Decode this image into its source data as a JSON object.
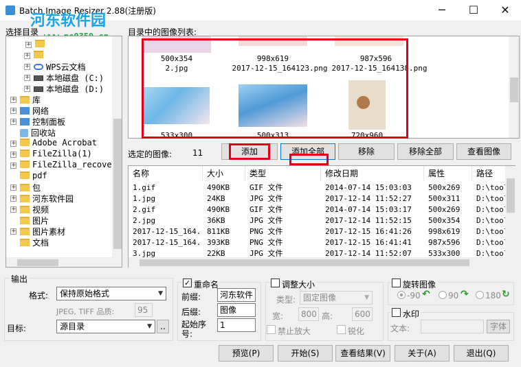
{
  "window": {
    "title": "Batch Image Resizer 2.88(注册版)",
    "minimize": "─",
    "maximize": "☐",
    "close": "✕"
  },
  "watermark": {
    "logo": "河东软件园",
    "url": "www.pc0359.cn"
  },
  "tree": {
    "label": "选择目录",
    "items": [
      {
        "label": "",
        "icon": "music-folder-icon"
      },
      {
        "label": "",
        "icon": "folder-icon"
      },
      {
        "label": "WPS云文档",
        "icon": "cloud-icon"
      },
      {
        "label": "本地磁盘 (C:)",
        "icon": "drive-icon"
      },
      {
        "label": "本地磁盘 (D:)",
        "icon": "drive-icon"
      },
      {
        "label": "库",
        "icon": "folder-icon"
      },
      {
        "label": "网络",
        "icon": "network-icon"
      },
      {
        "label": "控制面板",
        "icon": "control-panel-icon"
      },
      {
        "label": "回收站",
        "icon": "recycle-bin-icon"
      },
      {
        "label": "Adobe Acrobat",
        "icon": "folder-icon"
      },
      {
        "label": "FileZilla(1)",
        "icon": "folder-icon"
      },
      {
        "label": "FileZilla_recovered",
        "icon": "folder-icon"
      },
      {
        "label": "pdf",
        "icon": "folder-icon"
      },
      {
        "label": "包",
        "icon": "folder-icon"
      },
      {
        "label": "河东软件园",
        "icon": "folder-icon"
      },
      {
        "label": "视频",
        "icon": "folder-icon"
      },
      {
        "label": "图片",
        "icon": "folder-icon"
      },
      {
        "label": "图片素材",
        "icon": "folder-icon"
      },
      {
        "label": "文档",
        "icon": "folder-icon"
      }
    ]
  },
  "images_panel": {
    "label": "目录中的图像列表:",
    "thumbs": [
      {
        "size": "500x354",
        "name": "2.jpg"
      },
      {
        "size": "998x619",
        "name": "2017-12-15_164123.png"
      },
      {
        "size": "987x596",
        "name": "2017-12-15_164138.png"
      },
      {
        "size": "533x300",
        "name": ""
      },
      {
        "size": "500x313",
        "name": ""
      },
      {
        "size": "720x960",
        "name": ""
      }
    ]
  },
  "selected": {
    "label": "选定的图像:",
    "count": "11",
    "buttons": {
      "add": "添加",
      "add_all": "添加全部",
      "remove": "移除",
      "remove_all": "移除全部",
      "view": "查看图像"
    }
  },
  "table": {
    "columns": [
      "名称",
      "大小",
      "类型",
      "修改日期",
      "属性",
      "路径"
    ],
    "rows": [
      [
        "1.gif",
        "490KB",
        "GIF 文件",
        "2014-07-14 15:03:03",
        "500x269",
        "D:\\tool"
      ],
      [
        "1.jpg",
        "24KB",
        "JPG 文件",
        "2017-12-14 11:52:27",
        "500x311",
        "D:\\tool"
      ],
      [
        "2.gif",
        "490KB",
        "GIF 文件",
        "2014-07-14 15:03:17",
        "500x269",
        "D:\\tool"
      ],
      [
        "2.jpg",
        "36KB",
        "JPG 文件",
        "2017-12-14 11:52:15",
        "500x354",
        "D:\\tool"
      ],
      [
        "2017-12-15_164...",
        "811KB",
        "PNG 文件",
        "2017-12-15 16:41:26",
        "998x619",
        "D:\\tool"
      ],
      [
        "2017-12-15_164...",
        "393KB",
        "PNG 文件",
        "2017-12-15 16:41:41",
        "987x596",
        "D:\\tool"
      ],
      [
        "3.jpg",
        "22KB",
        "JPG 文件",
        "2017-12-14 11:52:07",
        "533x300",
        "D:\\tool"
      ]
    ]
  },
  "output": {
    "label": "输出",
    "format_label": "格式:",
    "format_value": "保持原始格式",
    "quality_label": "JPEG, TIFF 品质:",
    "quality_value": "95",
    "target_label": "目标:",
    "target_value": "源目录",
    "browse": ".."
  },
  "rename": {
    "label": "重命名",
    "prefix_label": "前缀:",
    "prefix_value": "河东软件",
    "suffix_label": "后缀:",
    "suffix_value": "图像",
    "start_label": "起始序号:",
    "start_value": "1"
  },
  "resize": {
    "label": "调整大小",
    "type_label": "类型:",
    "type_value": "固定图像",
    "width_label": "宽:",
    "width_value": "800",
    "height_label": "高:",
    "height_value": "600",
    "no_enlarge": "禁止放大",
    "sharpen": "锐化"
  },
  "rotate": {
    "label": "旋转图像",
    "options": [
      "-90",
      "90",
      "180"
    ]
  },
  "watermark_opt": {
    "label": "水印",
    "text_label": "文本:",
    "font_button": "字体"
  },
  "footer": {
    "preview": "预览(P)",
    "start": "开始(S)",
    "view_result": "查看结果(V)",
    "about": "关于(A)",
    "exit": "退出(Q)"
  }
}
